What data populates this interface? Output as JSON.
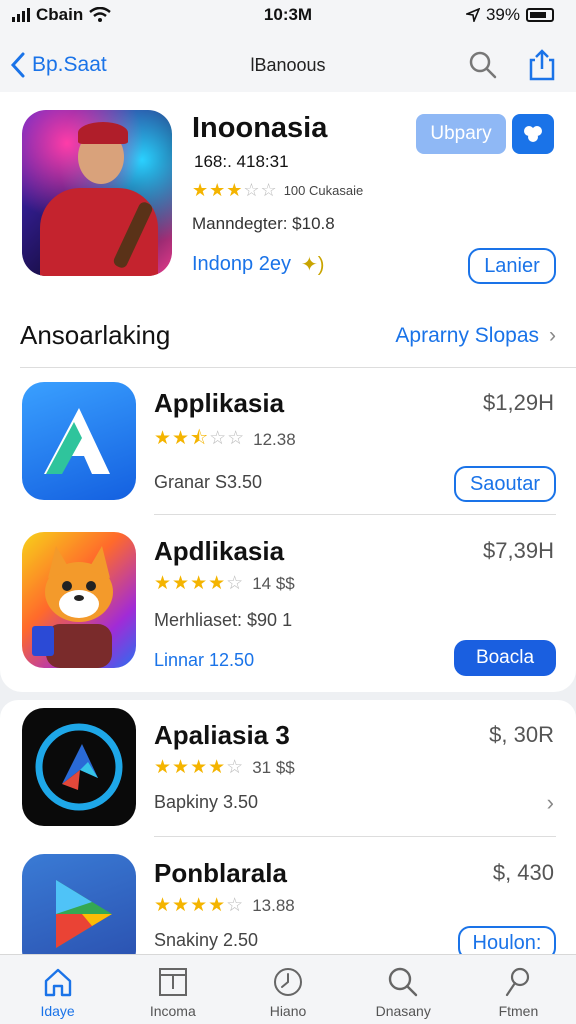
{
  "status": {
    "carrier": "Cbain",
    "time": "10:3M",
    "battery": "39%"
  },
  "nav": {
    "back_label": "Bp.Saat",
    "title": "lBanoous"
  },
  "featured": {
    "title": "Inoonasia",
    "subtitle": "168:. 418:31",
    "rating_stars": 3,
    "rating_count": "100 Cukasaie",
    "meta": "Manndegter: $10.8",
    "link_text": "Indonp 2ey",
    "primary_button": "Ubpary",
    "secondary_button": "Lanier"
  },
  "section": {
    "title": "Ansoarlaking",
    "link": "Aprarny Slopas"
  },
  "apps": [
    {
      "name": "Applikasia",
      "stars": 2.5,
      "rating_count": "12.38",
      "meta": "Granar S3.50",
      "price": "$1,29H",
      "action": "Saoutar",
      "action_style": "outline",
      "meta_style": "plain"
    },
    {
      "name": "Apdlikasia",
      "stars": 4,
      "rating_count": "14 $$",
      "meta": "Merhliaset: $90 1",
      "meta2": "Linnar 12.50",
      "price": "$7,39H",
      "action": "Boacla",
      "action_style": "filled",
      "meta_style": "plain"
    },
    {
      "name": "Apaliasia 3",
      "stars": 4,
      "rating_count": "31 $$",
      "meta": "Bapkiny 3.50",
      "price": "$, 30R",
      "action": "",
      "action_style": "chevron",
      "meta_style": "plain"
    },
    {
      "name": "Ponblarala",
      "stars": 4,
      "rating_count": "13.88",
      "meta": "Snakiny 2.50",
      "price": "$, 430",
      "action": "Houlon:",
      "action_style": "outline",
      "meta_style": "plain"
    }
  ],
  "tabs": [
    {
      "label": "Idaye",
      "icon": "home-icon",
      "active": true
    },
    {
      "label": "Incoma",
      "icon": "apps-icon",
      "active": false
    },
    {
      "label": "Hiano",
      "icon": "clock-icon",
      "active": false
    },
    {
      "label": "Dnasany",
      "icon": "search-icon",
      "active": false
    },
    {
      "label": "Ftmen",
      "icon": "person-icon",
      "active": false
    }
  ],
  "colors": {
    "accent": "#1a73e8",
    "star": "#f4b400"
  }
}
